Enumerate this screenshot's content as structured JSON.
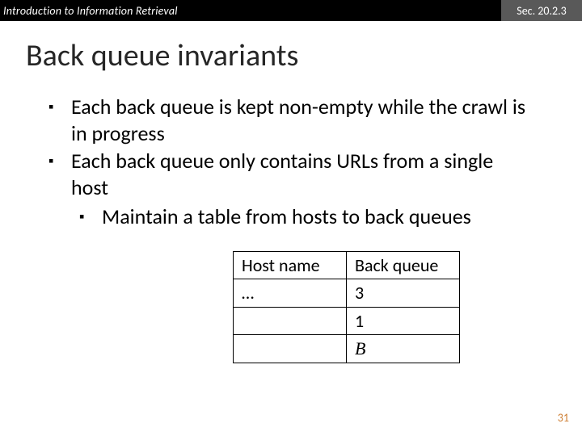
{
  "header": {
    "course": "Introduction to Information Retrieval",
    "section": "Sec. 20.2.3"
  },
  "title": "Back queue invariants",
  "bullets": {
    "b1": "Each back queue is kept non-empty while the crawl is in progress",
    "b2": "Each back queue only contains URLs from a single host",
    "b2a": "Maintain a table from hosts to back queues"
  },
  "table": {
    "h1": "Host name",
    "h2": "Back queue",
    "r1c1": "…",
    "r1c2": "3",
    "r2c1": "",
    "r2c2": "1",
    "r3c1": "",
    "r3c2": "B"
  },
  "page_number": "31"
}
